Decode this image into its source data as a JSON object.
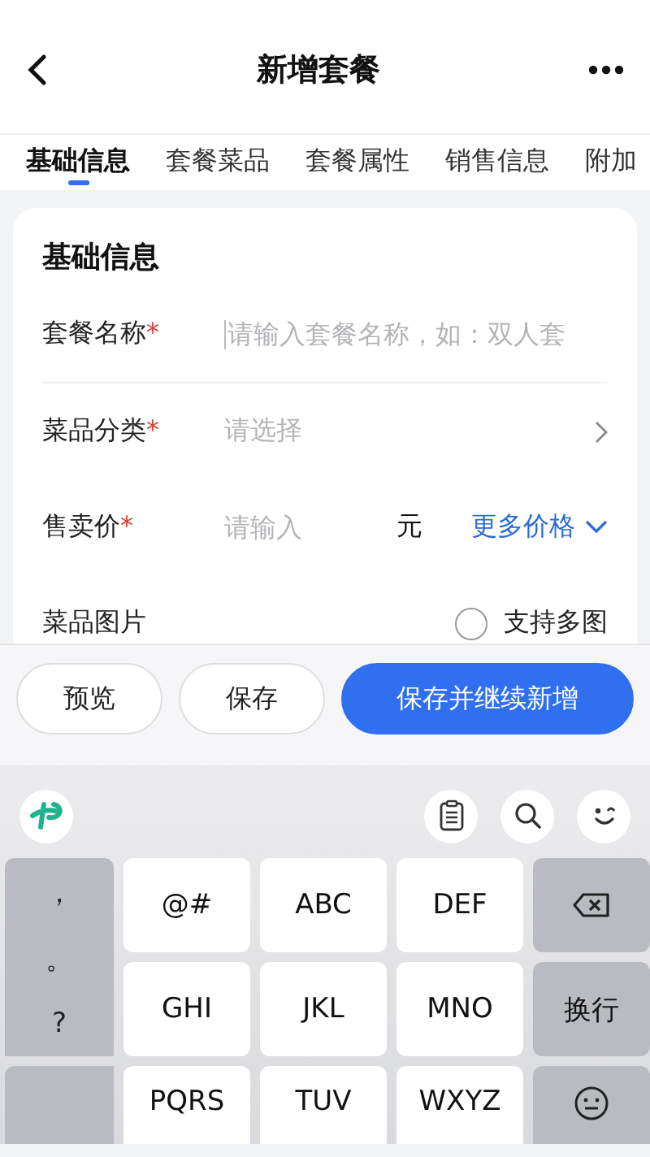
{
  "nav": {
    "title": "新增套餐"
  },
  "tabs": [
    {
      "label": "基础信息",
      "selected": true
    },
    {
      "label": "套餐菜品",
      "selected": false
    },
    {
      "label": "套餐属性",
      "selected": false
    },
    {
      "label": "销售信息",
      "selected": false
    },
    {
      "label": "附加",
      "selected": false
    }
  ],
  "form": {
    "title": "基础信息",
    "fields": [
      {
        "kind": "text",
        "label": "套餐名称",
        "required_mark": "*",
        "placeholder": "请输入套餐名称，如：双人套"
      },
      {
        "kind": "select",
        "label": "菜品分类",
        "required_mark": "*",
        "placeholder": "请选择"
      },
      {
        "kind": "price",
        "label": "售卖价",
        "required_mark": "*",
        "placeholder": "请输入",
        "unit": "元",
        "link": "更多价格"
      },
      {
        "kind": "image",
        "label": "菜品图片",
        "option": "支持多图",
        "checked": false
      }
    ]
  },
  "actions": [
    {
      "label": "预览",
      "primary": false
    },
    {
      "label": "保存",
      "primary": false
    },
    {
      "label": "保存并继续新增",
      "primary": true
    }
  ],
  "keyboard": {
    "punctuation": [
      "，",
      "。",
      "?"
    ],
    "keys": [
      "@#",
      "ABC",
      "DEF",
      "GHI",
      "JKL",
      "MNO",
      "PQRS",
      "TUV",
      "WXYZ"
    ],
    "enter": "换行"
  }
}
